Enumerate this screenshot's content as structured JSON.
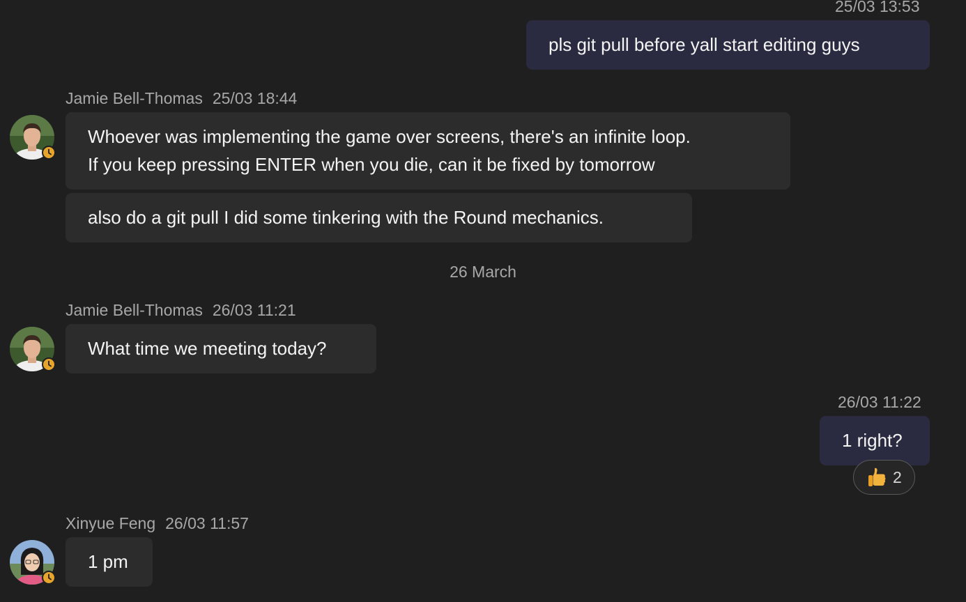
{
  "messages": {
    "m1": {
      "time": "25/03 13:53",
      "text": "pls git pull before yall start editing guys"
    },
    "m2": {
      "sender": "Jamie Bell-Thomas",
      "time": "25/03 18:44",
      "line1": "Whoever was implementing the game over screens, there's an infinite loop.",
      "line2": "If you keep pressing ENTER when you die, can it be fixed by tomorrow",
      "followup": "also do a git pull I did some tinkering with the Round mechanics."
    },
    "divider": "26 March",
    "m3": {
      "sender": "Jamie Bell-Thomas",
      "time": "26/03 11:21",
      "text": "What time we meeting today?"
    },
    "m4": {
      "time": "26/03 11:22",
      "text": "1 right?",
      "reaction": {
        "icon": "thumbs-up-icon",
        "count": "2"
      }
    },
    "m5": {
      "sender": "Xinyue Feng",
      "time": "26/03 11:57",
      "text": "1 pm"
    }
  },
  "colors": {
    "background": "#1f1f1f",
    "bubble_other": "#2c2c2c",
    "bubble_mine": "#2a2b40",
    "status_away": "#e8a52c"
  }
}
